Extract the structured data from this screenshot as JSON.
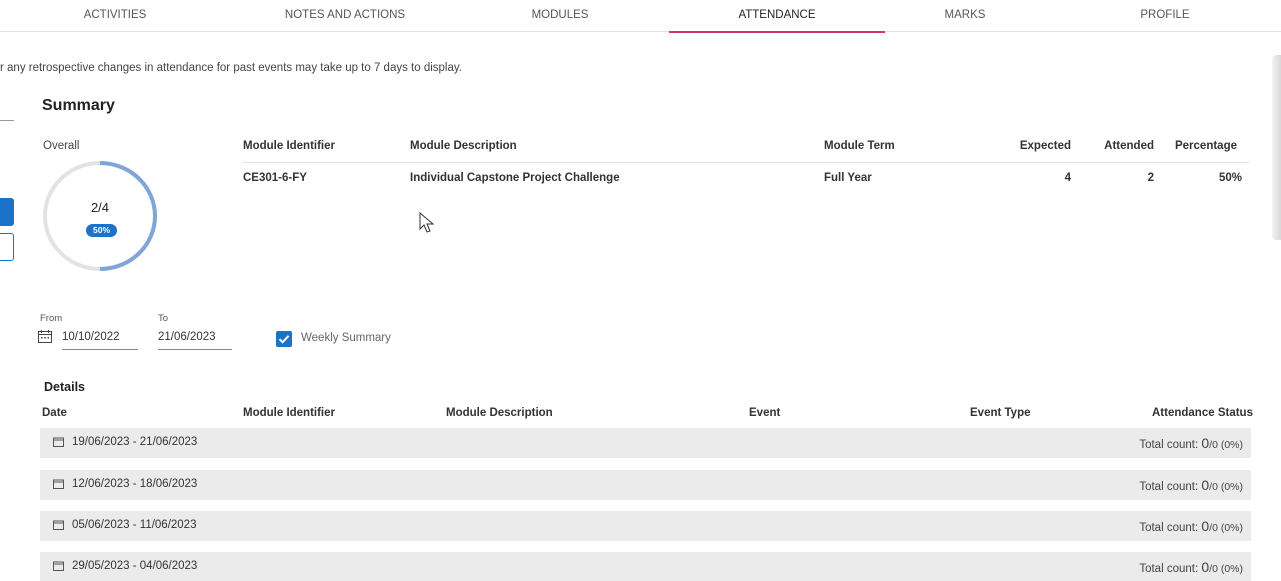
{
  "tabs": [
    {
      "label": "ACTIVITIES"
    },
    {
      "label": "NOTES AND ACTIONS"
    },
    {
      "label": "MODULES"
    },
    {
      "label": "ATTENDANCE"
    },
    {
      "label": "MARKS"
    },
    {
      "label": "PROFILE"
    }
  ],
  "notice": "r any retrospective changes in attendance for past events may take up to 7 days to display.",
  "summary": {
    "title": "Summary",
    "overall_label": "Overall",
    "ring_value": "2/4",
    "ring_percent": "50%",
    "ring_fraction": 0.5,
    "headers": {
      "module_identifier": "Module Identifier",
      "module_description": "Module Description",
      "module_term": "Module Term",
      "expected": "Expected",
      "attended": "Attended",
      "percentage": "Percentage"
    },
    "row": {
      "module_identifier": "CE301-6-FY",
      "module_description": "Individual Capstone Project Challenge",
      "module_term": "Full Year",
      "expected": "4",
      "attended": "2",
      "percentage": "50%"
    }
  },
  "filters": {
    "from_label": "From",
    "from_value": "10/10/2022",
    "to_label": "To",
    "to_value": "21/06/2023",
    "weekly_summary_label": "Weekly Summary",
    "weekly_summary_checked": true
  },
  "details": {
    "title": "Details",
    "headers": {
      "date": "Date",
      "module_identifier": "Module Identifier",
      "module_description": "Module Description",
      "event": "Event",
      "event_type": "Event Type",
      "attendance_status": "Attendance Status"
    },
    "rows": [
      {
        "date": "19/06/2023 - 21/06/2023",
        "total_prefix": "Total count: ",
        "count": "0",
        "of": "/0 (0%)"
      },
      {
        "date": "12/06/2023 - 18/06/2023",
        "total_prefix": "Total count: ",
        "count": "0",
        "of": "/0 (0%)"
      },
      {
        "date": "05/06/2023 - 11/06/2023",
        "total_prefix": "Total count: ",
        "count": "0",
        "of": "/0 (0%)"
      },
      {
        "date": "29/05/2023 - 04/06/2023",
        "total_prefix": "Total count: ",
        "count": "0",
        "of": "/0 (0%)"
      }
    ]
  },
  "colors": {
    "accent": "#1a73c8",
    "tab_indicator": "#d6336c",
    "ring_track": "#e3e3e3",
    "ring_fill": "#7fa6d6",
    "row_bg": "#ebebeb"
  }
}
